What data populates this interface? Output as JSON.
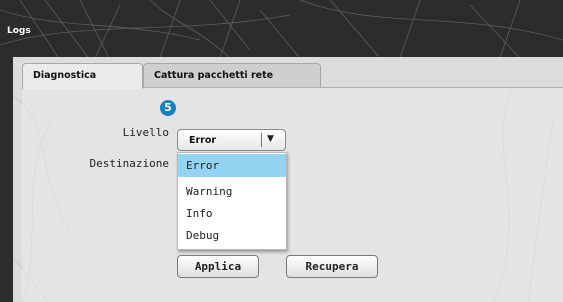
{
  "window": {
    "title": "Logs"
  },
  "tabs": [
    {
      "label": "Diagnostica",
      "active": true
    },
    {
      "label": "Cattura pacchetti rete",
      "active": false
    }
  ],
  "callout_badge": "5",
  "form": {
    "level_label": "Livello",
    "destination_label": "Destinazione",
    "level_select": {
      "selected": "Error",
      "options": [
        "Error",
        "Warning",
        "Info",
        "Debug"
      ],
      "highlighted_option": "Error",
      "expanded": true
    }
  },
  "buttons": {
    "apply": "Applica",
    "retrieve": "Recupera"
  },
  "colors": {
    "header_bg": "#2c2c2c",
    "panel_bg": "#dcdcdc",
    "badge": "#1a7fc1",
    "highlight": "#94d2f2"
  }
}
